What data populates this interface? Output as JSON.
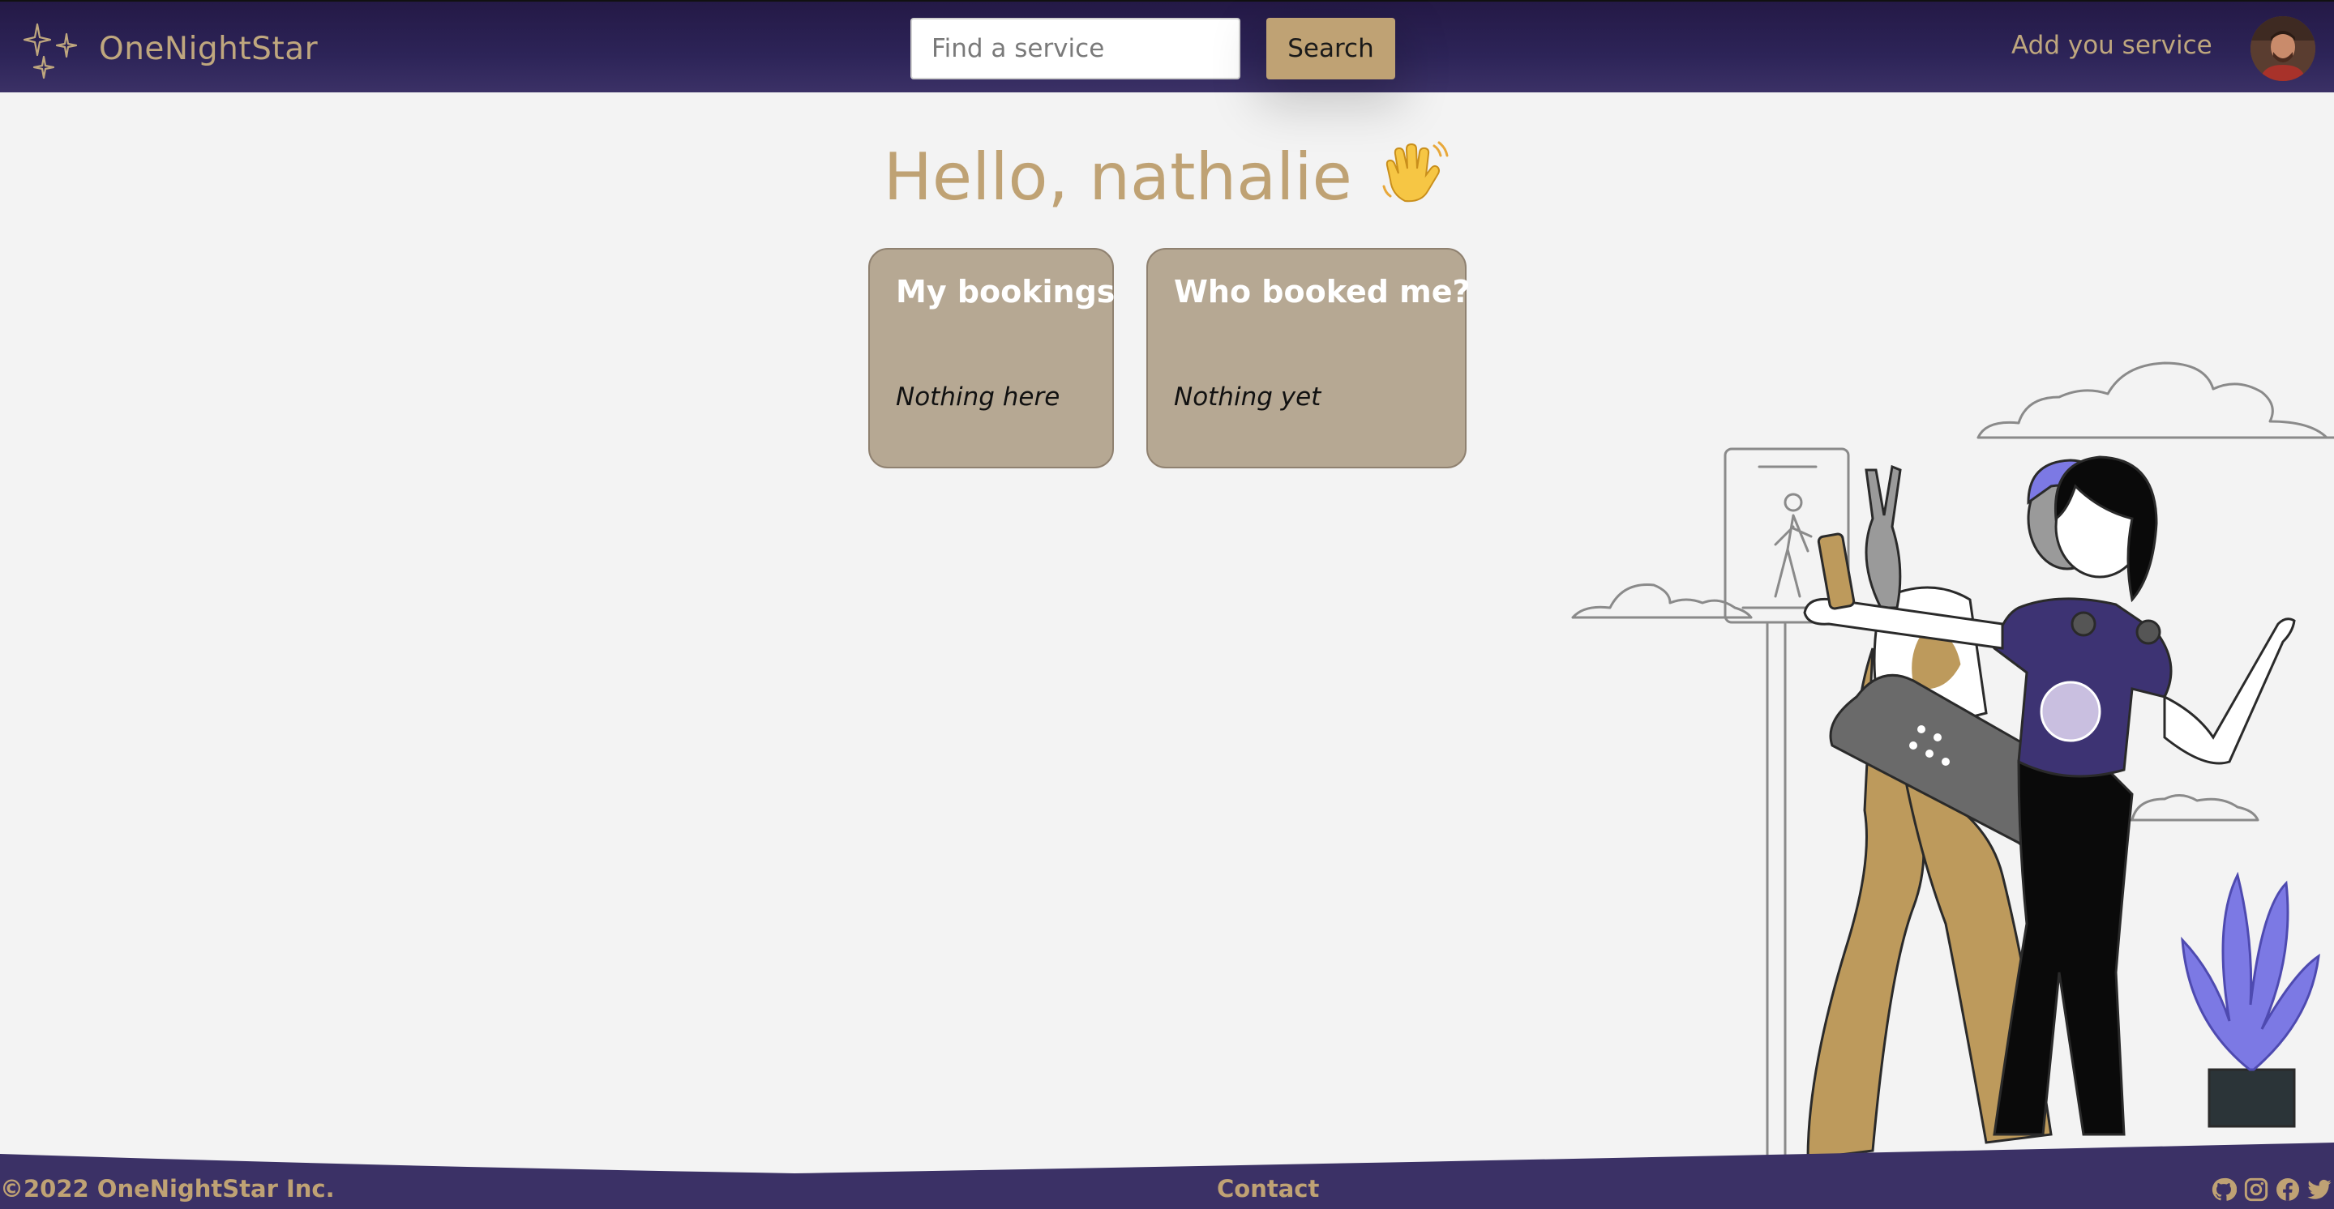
{
  "colors": {
    "nav_bg": "#2d2458",
    "accent_gold": "#bfa274",
    "card_bg": "#b6a893",
    "page_bg": "#f3f3f3",
    "footer_bg": "#3b3166"
  },
  "header": {
    "brand_name": "OneNightStar",
    "brand_icon": "sparkle-stars-icon",
    "search": {
      "placeholder": "Find a service",
      "value": "",
      "button_label": "Search"
    },
    "add_service_label": "Add you service",
    "avatar_icon": "user-avatar"
  },
  "main": {
    "greeting": "Hello, nathalie",
    "greeting_emoji": "waving-hand-icon",
    "cards": [
      {
        "title": "My bookings",
        "empty_text": "Nothing here"
      },
      {
        "title": "Who booked me?",
        "empty_text": "Nothing yet"
      }
    ],
    "illustration": "selfie-friends-illustration"
  },
  "footer": {
    "copyright": "©2022 OneNightStar Inc.",
    "contact_label": "Contact",
    "social_icons": [
      "github-icon",
      "instagram-icon",
      "facebook-icon",
      "twitter-icon"
    ]
  }
}
